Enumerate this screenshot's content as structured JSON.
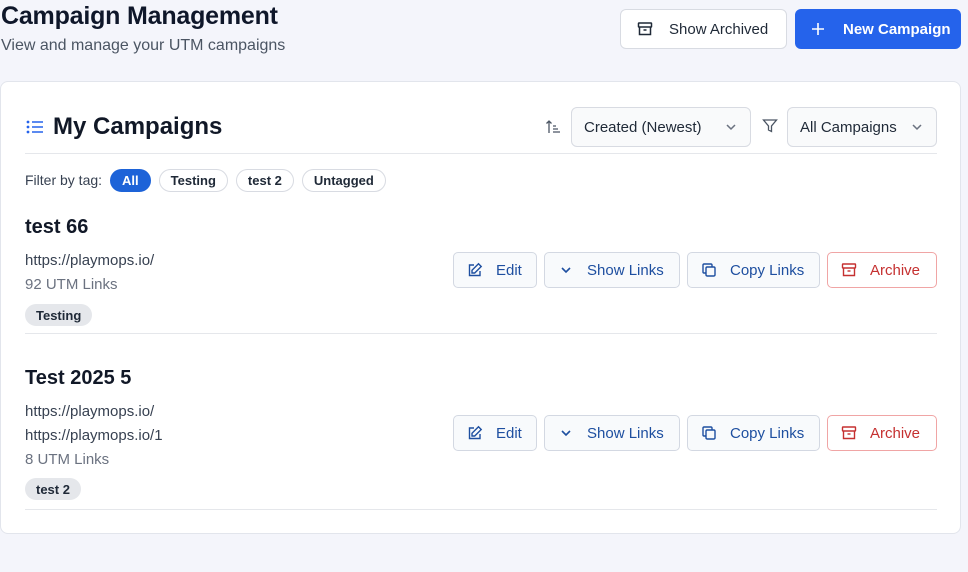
{
  "header": {
    "title": "Campaign Management",
    "subtitle": "View and manage your UTM campaigns",
    "show_archived_label": "Show Archived",
    "new_campaign_label": "New Campaign"
  },
  "card": {
    "title": "My Campaigns",
    "sort_value": "Created (Newest)",
    "filter_value": "All Campaigns"
  },
  "tag_filter": {
    "label": "Filter by tag:",
    "chips": [
      "All",
      "Testing",
      "test 2",
      "Untagged"
    ],
    "active": "All"
  },
  "campaigns": [
    {
      "name": "test 66",
      "urls": [
        "https://playmops.io/"
      ],
      "link_count": "92 UTM Links",
      "tag": "Testing"
    },
    {
      "name": "Test 2025 5",
      "urls": [
        "https://playmops.io/",
        "https://playmops.io/1"
      ],
      "link_count": "8 UTM Links",
      "tag": "test 2"
    }
  ],
  "actions": {
    "edit": "Edit",
    "show_links": "Show Links",
    "copy_links": "Copy Links",
    "archive": "Archive"
  },
  "colors": {
    "primary": "#2563eb",
    "active_chip": "#1d63d8",
    "action_text": "#1e4fa0",
    "danger": "#c53030"
  },
  "icons": {
    "show_archived": "archive-icon",
    "new_campaign": "plus-icon",
    "card_title": "list-icon",
    "sort": "sort-ascending-icon",
    "filter": "filter-icon",
    "edit": "edit-icon",
    "show_links": "chevron-down-icon",
    "copy_links": "copy-icon",
    "archive": "archive-icon"
  }
}
